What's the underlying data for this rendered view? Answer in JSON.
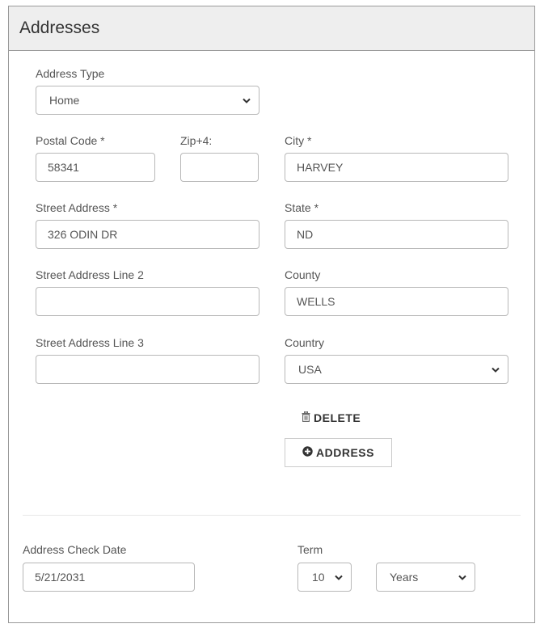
{
  "panel": {
    "title": "Addresses"
  },
  "address_type": {
    "label": "Address Type",
    "value": "Home"
  },
  "postal_code": {
    "label": "Postal Code *",
    "value": "58341"
  },
  "zip4": {
    "label": "Zip+4:",
    "value": ""
  },
  "city": {
    "label": "City *",
    "value": "HARVEY"
  },
  "street1": {
    "label": "Street Address *",
    "value": "326 ODIN DR"
  },
  "state": {
    "label": "State *",
    "value": "ND"
  },
  "street2": {
    "label": "Street Address Line 2",
    "value": ""
  },
  "county": {
    "label": "County",
    "value": "WELLS"
  },
  "street3": {
    "label": "Street Address Line 3",
    "value": ""
  },
  "country": {
    "label": "Country",
    "value": "USA"
  },
  "actions": {
    "delete_label": "DELETE",
    "add_address_label": "ADDRESS"
  },
  "check_date": {
    "label": "Address Check Date",
    "value": "5/21/2031"
  },
  "term": {
    "label": "Term",
    "number": "10",
    "unit": "Years"
  },
  "icons": {
    "delete": "trash-icon",
    "add": "plus-circle-icon",
    "dropdown": "chevron-down-icon"
  }
}
